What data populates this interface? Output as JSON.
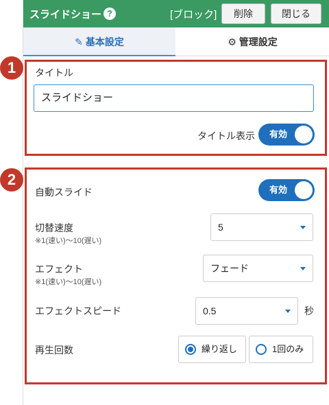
{
  "header": {
    "title": "スライドショー",
    "help_icon": "?",
    "block_label": "[ブロック]",
    "delete_label": "削除",
    "close_label": "閉じる",
    "color": "#3a9a62"
  },
  "tabs": [
    {
      "label": "基本設定",
      "icon": "edit-icon",
      "active": true
    },
    {
      "label": "管理設定",
      "icon": "gear-icon",
      "active": false
    }
  ],
  "badges": [
    "1",
    "2"
  ],
  "section1": {
    "title_label": "タイトル",
    "title_value": "スライドショー",
    "title_display_label": "タイトル表示",
    "title_display_toggle": "有効"
  },
  "section2": {
    "auto_slide_label": "自動スライド",
    "auto_slide_toggle": "有効",
    "switch_speed_label": "切替速度",
    "switch_speed_note": "※1(速い)〜10(遅い)",
    "switch_speed_value": "5",
    "effect_label": "エフェクト",
    "effect_note": "※1(速い)〜10(遅い)",
    "effect_value": "フェード",
    "effect_speed_label": "エフェクトスピード",
    "effect_speed_value": "0.5",
    "effect_speed_unit": "秒",
    "playback_label": "再生回数",
    "playback_options": [
      {
        "label": "繰り返し",
        "selected": true
      },
      {
        "label": "1回のみ",
        "selected": false
      }
    ]
  },
  "colors": {
    "accent": "#1f6fbd",
    "highlight": "#c0392b"
  }
}
